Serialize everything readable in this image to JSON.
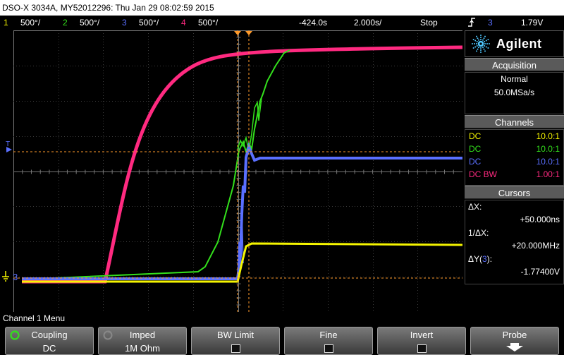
{
  "title": "DSO-X 3034A, MY52012296: Thu Jan 29 08:02:59 2015",
  "status": {
    "channels": [
      {
        "num": "1",
        "scale": "500°/",
        "color": "#f5f500"
      },
      {
        "num": "2",
        "scale": "500°/",
        "color": "#33e01c"
      },
      {
        "num": "3",
        "scale": "500°/",
        "color": "#5a6fff"
      },
      {
        "num": "4",
        "scale": "500°/",
        "color": "#ff2a80"
      }
    ],
    "delay": "-424.0s",
    "timebase": "2.000s/",
    "run_state": "Stop",
    "trigger_icon": "trigger-edge-icon",
    "trigger_source": "3",
    "trigger_level": "1.79V"
  },
  "brand": {
    "name": "Agilent",
    "icon": "agilent-spark-icon"
  },
  "acquisition": {
    "header": "Acquisition",
    "mode": "Normal",
    "rate": "50.0MSa/s"
  },
  "channels_panel": {
    "header": "Channels",
    "rows": [
      {
        "coupling": "DC",
        "probe": "10.0:1",
        "color": "#f5f500"
      },
      {
        "coupling": "DC",
        "probe": "10.0:1",
        "color": "#33e01c"
      },
      {
        "coupling": "DC",
        "probe": "10.0:1",
        "color": "#5a6fff"
      },
      {
        "coupling": "DC BW",
        "probe": "1.00:1",
        "color": "#ff2a80"
      }
    ]
  },
  "cursors": {
    "header": "Cursors",
    "dx_label": "ΔX:",
    "dx_value": "+50.000ns",
    "inv_label": "1/ΔX:",
    "inv_value": "+20.000MHz",
    "dy_label_pre": "ΔY(",
    "dy_source": "3",
    "dy_label_post": "):",
    "dy_value": "-1.77400V"
  },
  "markers": {
    "trigger_T": "T",
    "ch3_marker": "3"
  },
  "menu": {
    "title": "Channel 1 Menu",
    "softkeys": [
      {
        "label": "Coupling",
        "value": "DC",
        "icon": "knob-arrow-icon"
      },
      {
        "label": "Imped",
        "value": "1M Ohm",
        "icon": "knob-arrow-icon"
      },
      {
        "label": "BW Limit",
        "checkbox": true
      },
      {
        "label": "Fine",
        "checkbox": true
      },
      {
        "label": "Invert",
        "checkbox": true
      },
      {
        "label": "Probe",
        "icon": "down-arrow-icon"
      }
    ]
  }
}
